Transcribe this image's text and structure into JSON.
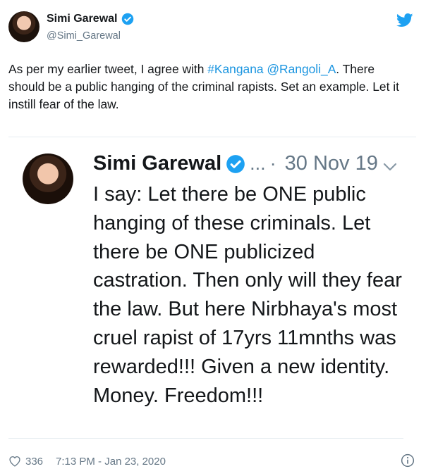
{
  "author": {
    "display_name": "Simi Garewal",
    "handle": "@Simi_Garewal"
  },
  "tweet": {
    "text_before": "As per my earlier tweet, I agree with ",
    "hashtag": "#Kangana",
    "space": " ",
    "mention": "@Rangoli_A",
    "text_after": ". There should be a public hanging of the criminal rapists. Set an example. Let it instill fear of the law."
  },
  "quoted_tweet": {
    "display_name": "Simi Garewal",
    "handle_truncated": "...",
    "separator": "·",
    "date": "30 Nov 19",
    "body": "I say: Let there be ONE public hanging of these criminals. Let there be ONE  publicized castration. Then only will they fear the law. But here Nirbhaya's most cruel rapist of 17yrs 11mnths was rewarded!!! Given a new identity. Money. Freedom!!!"
  },
  "footer": {
    "like_count": "336",
    "timestamp": "7:13 PM - Jan 23, 2020"
  },
  "colors": {
    "link": "#1b95e0",
    "verified": "#1da1f2",
    "muted": "#657786"
  }
}
